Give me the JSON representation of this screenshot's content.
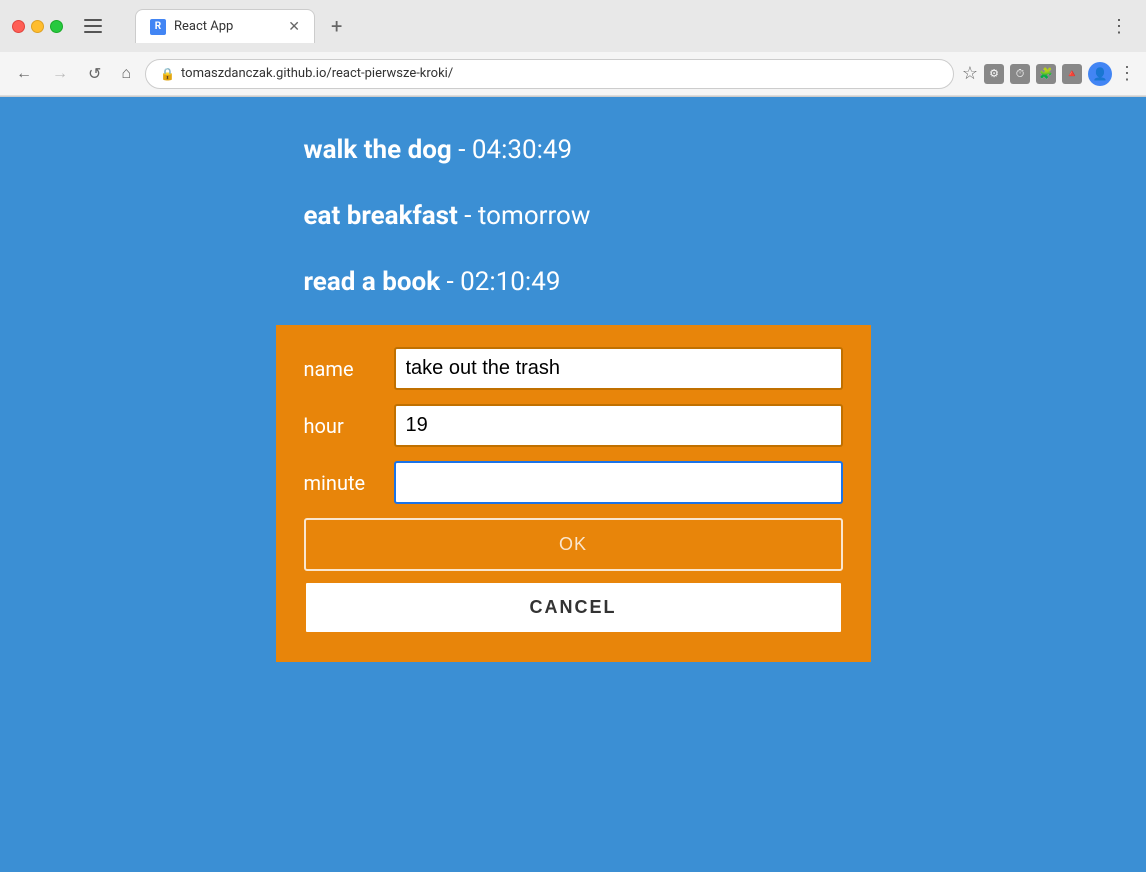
{
  "browser": {
    "tab_title": "React App",
    "url": "tomaszdanczak.github.io/react-pierwsze-kroki/",
    "back_btn": "←",
    "forward_btn": "→",
    "reload_btn": "↺",
    "home_btn": "⌂"
  },
  "tasks": [
    {
      "name": "walk the dog",
      "time": "04:30:49"
    },
    {
      "name": "eat breakfast",
      "time": "tomorrow"
    },
    {
      "name": "read a book",
      "time": "02:10:49"
    }
  ],
  "form": {
    "name_label": "name",
    "hour_label": "hour",
    "minute_label": "minute",
    "name_value": "take out the trash",
    "hour_value": "19",
    "minute_value": "",
    "ok_label": "OK",
    "cancel_label": "CANCEL"
  }
}
